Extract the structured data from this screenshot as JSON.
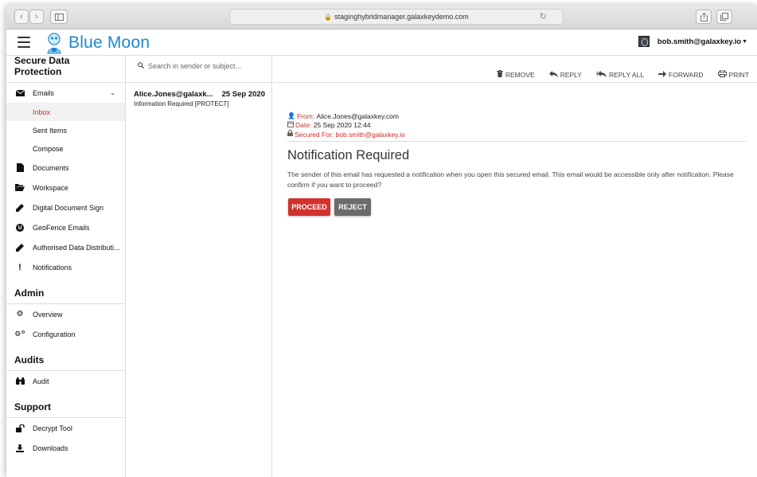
{
  "browser": {
    "url": "staginghybridmanager.galaxkeydemo.com"
  },
  "app": {
    "logo_text": "Blue Moon",
    "user_email": "bob.smith@galaxkey.io"
  },
  "sidebar": {
    "sections": [
      {
        "title": "Secure Data Protection",
        "items": [
          {
            "label": "Emails",
            "icon": "envelope-icon",
            "expanded": true,
            "children": [
              {
                "label": "Inbox",
                "active": true
              },
              {
                "label": "Sent Items",
                "active": false
              },
              {
                "label": "Compose",
                "active": false
              }
            ]
          },
          {
            "label": "Documents",
            "icon": "document-icon"
          },
          {
            "label": "Workspace",
            "icon": "folder-open-icon"
          },
          {
            "label": "Digital Document Sign",
            "icon": "pen-icon"
          },
          {
            "label": "GeoFence Emails",
            "icon": "globe-icon"
          },
          {
            "label": "Authorised Data Distributi...",
            "icon": "pen-icon"
          },
          {
            "label": "Notifications",
            "icon": "exclamation-icon"
          }
        ]
      },
      {
        "title": "Admin",
        "items": [
          {
            "label": "Overview",
            "icon": "gear-icon"
          },
          {
            "label": "Configuration",
            "icon": "gears-icon"
          }
        ]
      },
      {
        "title": "Audits",
        "items": [
          {
            "label": "Audit",
            "icon": "binoculars-icon"
          }
        ]
      },
      {
        "title": "Support",
        "items": [
          {
            "label": "Decrypt Tool",
            "icon": "unlock-icon"
          },
          {
            "label": "Downloads",
            "icon": "download-icon"
          }
        ]
      }
    ]
  },
  "messages": {
    "search_placeholder": "Search in sender or subject...",
    "items": [
      {
        "sender": "Alice.Jones@galaxk...",
        "date": "25 Sep 2020",
        "subject": "Information Required [PROTECT]"
      }
    ]
  },
  "toolbar": {
    "remove": "REMOVE",
    "reply": "REPLY",
    "reply_all": "REPLY ALL",
    "forward": "FORWARD",
    "print": "PRINT"
  },
  "email": {
    "from_label": "From:",
    "from_value": "Alice.Jones@galaxkey.com",
    "date_label": "Date:",
    "date_value": "25 Sep 2020 12:44",
    "secured_label": "Secured For:",
    "secured_value": "bob.smith@galaxkey.io"
  },
  "notification": {
    "title": "Notification Required",
    "body": "The sender of this email has requested a notification when you open this secured email. This email would be accessible only after notification. Please confirm if you want to proceed?",
    "proceed_label": "PROCEED",
    "reject_label": "REJECT"
  },
  "colors": {
    "brand_blue": "#1e88d0",
    "accent_red": "#d2322d",
    "reject_gray": "#6b6b6b"
  }
}
